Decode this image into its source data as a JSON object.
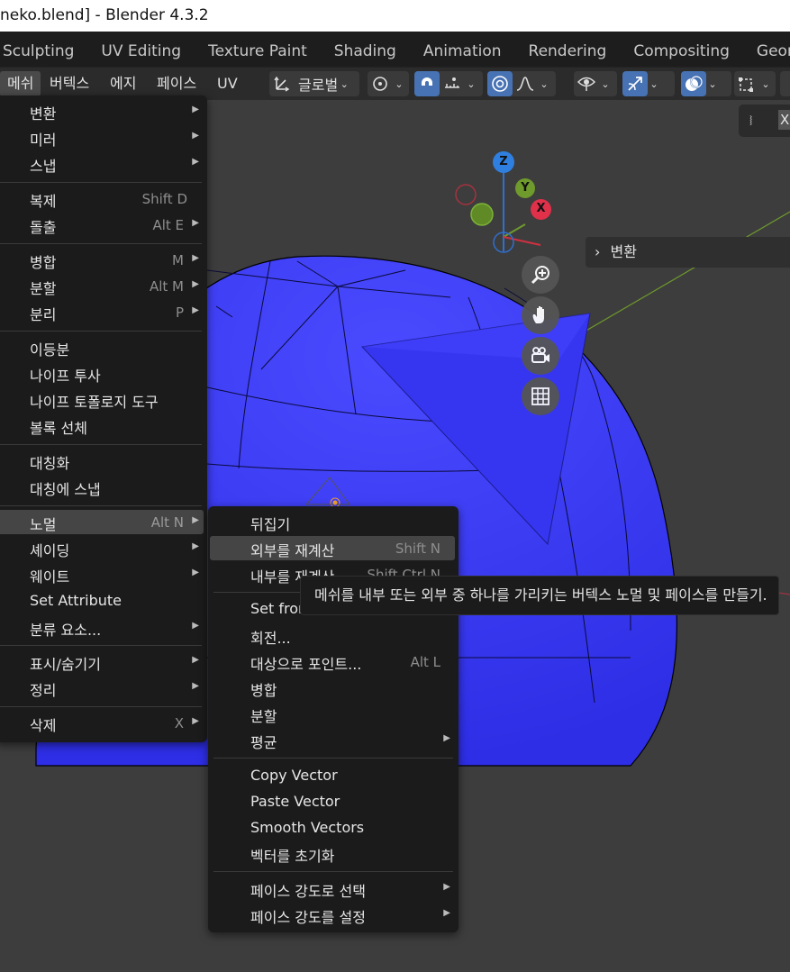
{
  "window": {
    "title": "neko.blend] - Blender 4.3.2"
  },
  "workspaces": [
    "Sculpting",
    "UV Editing",
    "Texture Paint",
    "Shading",
    "Animation",
    "Rendering",
    "Compositing",
    "Geometry Nodes"
  ],
  "header": {
    "menus": [
      "메쉬",
      "버텍스",
      "에지",
      "페이스",
      "UV"
    ],
    "transform_orientation": "글로벌",
    "overlay_letter": "X"
  },
  "viewport_panel": {
    "label": "변환"
  },
  "gizmo": {
    "z": "Z",
    "y": "Y",
    "x": "X"
  },
  "mesh_menu": {
    "items": [
      {
        "label": "변환",
        "shortcut": "",
        "submenu": true
      },
      {
        "label": "미러",
        "shortcut": "",
        "submenu": true
      },
      {
        "label": "스냅",
        "shortcut": "",
        "submenu": true
      },
      {
        "label": "복제",
        "shortcut": "Shift D",
        "submenu": false
      },
      {
        "label": "돌출",
        "shortcut": "Alt E",
        "submenu": true
      },
      {
        "label": "병합",
        "shortcut": "M",
        "submenu": true
      },
      {
        "label": "분할",
        "shortcut": "Alt M",
        "submenu": true
      },
      {
        "label": "분리",
        "shortcut": "P",
        "submenu": true
      },
      {
        "label": "이등분",
        "shortcut": "",
        "submenu": false
      },
      {
        "label": "나이프 투사",
        "shortcut": "",
        "submenu": false
      },
      {
        "label": "나이프 토폴로지 도구",
        "shortcut": "",
        "submenu": false
      },
      {
        "label": "볼록 선체",
        "shortcut": "",
        "submenu": false
      },
      {
        "label": "대칭화",
        "shortcut": "",
        "submenu": false
      },
      {
        "label": "대칭에 스냅",
        "shortcut": "",
        "submenu": false
      },
      {
        "label": "노멀",
        "shortcut": "Alt N",
        "submenu": true
      },
      {
        "label": "셰이딩",
        "shortcut": "",
        "submenu": true
      },
      {
        "label": "웨이트",
        "shortcut": "",
        "submenu": true
      },
      {
        "label": "Set Attribute",
        "shortcut": "",
        "submenu": false
      },
      {
        "label": "분류 요소...",
        "shortcut": "",
        "submenu": true
      },
      {
        "label": "표시/숨기기",
        "shortcut": "",
        "submenu": true
      },
      {
        "label": "정리",
        "shortcut": "",
        "submenu": true
      },
      {
        "label": "삭제",
        "shortcut": "X",
        "submenu": true
      }
    ]
  },
  "normals_menu": {
    "items": [
      {
        "label": "뒤집기",
        "shortcut": "",
        "submenu": false
      },
      {
        "label": "외부를 재계산",
        "shortcut": "Shift N",
        "submenu": false
      },
      {
        "label": "내부를 재계산",
        "shortcut": "Shift Ctrl N",
        "submenu": false
      },
      {
        "label": "Set from Faces",
        "shortcut": "",
        "submenu": false
      },
      {
        "label": "회전...",
        "shortcut": "",
        "submenu": false
      },
      {
        "label": "대상으로 포인트...",
        "shortcut": "Alt L",
        "submenu": false
      },
      {
        "label": "병합",
        "shortcut": "",
        "submenu": false
      },
      {
        "label": "분할",
        "shortcut": "",
        "submenu": false
      },
      {
        "label": "평균",
        "shortcut": "",
        "submenu": true
      },
      {
        "label": "Copy Vector",
        "shortcut": "",
        "submenu": false
      },
      {
        "label": "Paste Vector",
        "shortcut": "",
        "submenu": false
      },
      {
        "label": "Smooth Vectors",
        "shortcut": "",
        "submenu": false
      },
      {
        "label": "벡터를 초기화",
        "shortcut": "",
        "submenu": false
      },
      {
        "label": "페이스 강도로 선택",
        "shortcut": "",
        "submenu": true
      },
      {
        "label": "페이스 강도를 설정",
        "shortcut": "",
        "submenu": true
      }
    ]
  },
  "tooltip": {
    "text": "메쉬를 내부 또는 외부 중 하나를 가리키는 버텍스 노멀 및 페이스를 만들기."
  },
  "colors": {
    "mesh": "#3b3bf2",
    "highlight": "#454545",
    "accent": "#4772b3"
  }
}
